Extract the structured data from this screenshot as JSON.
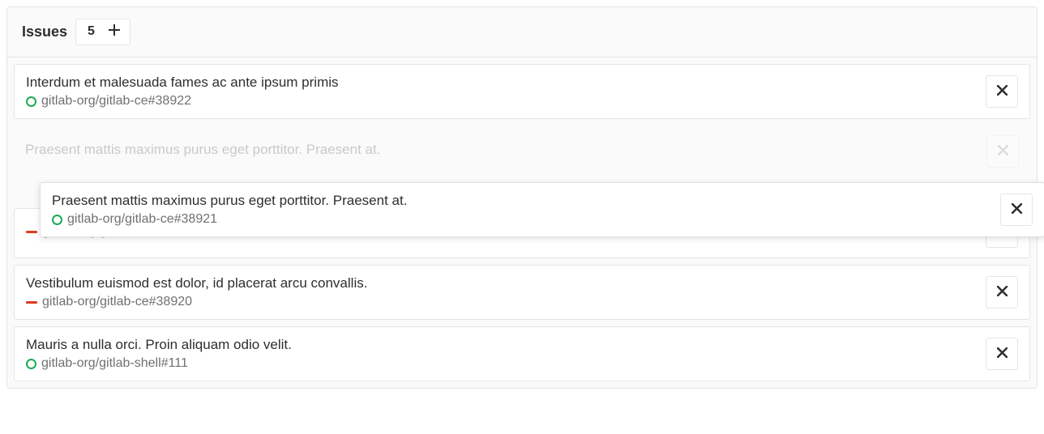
{
  "panel": {
    "title": "Issues",
    "count": "5"
  },
  "issues": [
    {
      "title": "Interdum et malesuada fames ac ante ipsum primis",
      "ref": "gitlab-org/gitlab-ce#38922",
      "status": "open"
    },
    {
      "title": "Praesent mattis maximus purus eget porttitor. Praesent at.",
      "ref": "",
      "status": "ghost"
    },
    {
      "title": "Praesent mattis maximus purus eget porttitor. Praesent at.",
      "ref": "gitlab-org/gitlab-ce#38921",
      "status": "open",
      "dragging": true
    },
    {
      "title": "",
      "ref": "gitlab-org/gitlab-shell#112",
      "status": "closed",
      "partial": true
    },
    {
      "title": "Vestibulum euismod est dolor, id placerat arcu convallis.",
      "ref": "gitlab-org/gitlab-ce#38920",
      "status": "closed"
    },
    {
      "title": "Mauris a nulla orci. Proin aliquam odio velit.",
      "ref": "gitlab-org/gitlab-shell#111",
      "status": "open"
    }
  ]
}
